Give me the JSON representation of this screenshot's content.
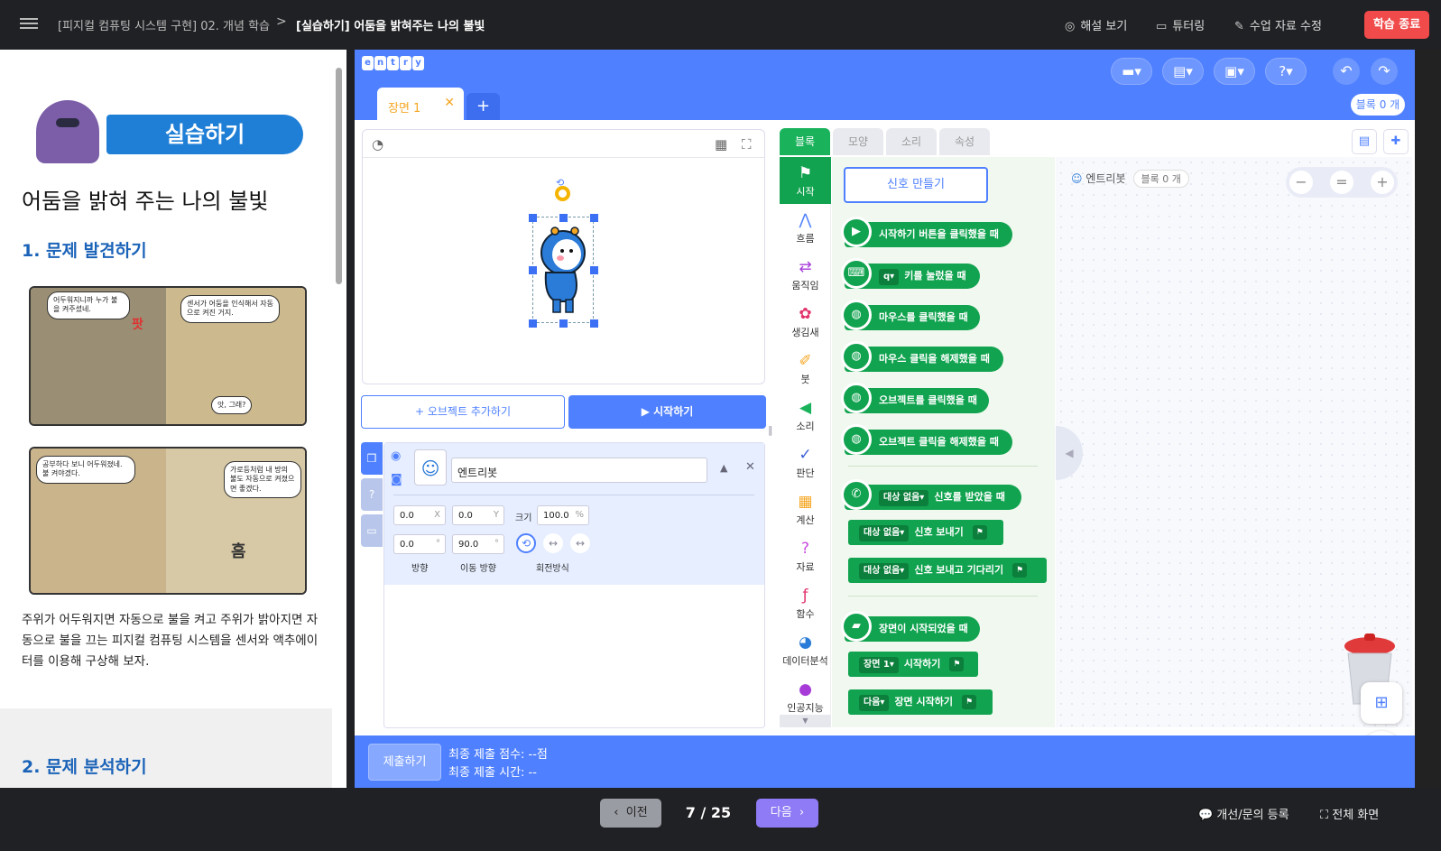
{
  "topbar": {
    "breadcrumb": "[피지컬 컴퓨팅 시스템 구현] 02. 개념 학습",
    "breadcrumb_sep": ">",
    "current": "[실습하기] 어둠을 밝혀주는 나의 불빛",
    "actions": [
      {
        "label": "해설 보기",
        "icon": "check-circle-icon"
      },
      {
        "label": "튜터링",
        "icon": "chat-edit-icon"
      },
      {
        "label": "수업 자료 수정",
        "icon": "edit-icon"
      }
    ],
    "finish": "학습 종료"
  },
  "lesson": {
    "badge": "실습하기",
    "title": "어둠을 밝혀 주는 나의 불빛",
    "section1": "1. 문제 발견하기",
    "comic1": {
      "bubble_a": "어두워지니까 누가 불을 켜주셨네.",
      "bubble_b": "센서가 어둠을 인식해서 자동으로 켜진 거지.",
      "bubble_c": "앗, 그래?",
      "sfx": "팟"
    },
    "comic2": {
      "bubble_a": "공부하다 보니 어두워졌네. 불 켜야겠다.",
      "bubble_b": "가로등처럼 내 방의 불도 자동으로 켜졌으면 좋겠다.",
      "sfx": "흠"
    },
    "paragraph": "주위가 어두워지면 자동으로 불을 켜고 주위가 밝아지면 자동으로 불을 끄는 피지컬 컴퓨팅 시스템을 센서와 액추에이터를 이용해 구상해 보자.",
    "section2": "2. 문제 분석하기"
  },
  "entry": {
    "logo": [
      "e",
      "n",
      "t",
      "r",
      "y"
    ],
    "block_count_top": "블록 0 개",
    "scene_tab": "장면 1",
    "scene_add": "+",
    "add_object": "+ 오브젝트 추가하기",
    "start": "▶ 시작하기",
    "object": {
      "name": "엔트리봇",
      "x": "0.0",
      "x_unit": "X",
      "y": "0.0",
      "y_unit": "Y",
      "size_label": "크기",
      "size": "100.0",
      "size_unit": "%",
      "direction": "0.0",
      "move_direction": "90.0",
      "deg": "°",
      "direction_label": "방향",
      "move_direction_label": "이동 방향",
      "rotation_label": "회전방식"
    },
    "tabs": [
      "블록",
      "모양",
      "소리",
      "속성"
    ],
    "categories": [
      "시작",
      "흐름",
      "움직임",
      "생김새",
      "붓",
      "소리",
      "판단",
      "계산",
      "자료",
      "함수",
      "데이터분석",
      "인공지능"
    ],
    "signal_button": "신호 만들기",
    "blocks": {
      "b1": "시작하기 버튼을 클릭했을 때",
      "b2_key": "q",
      "b2": "키를 눌렀을 때",
      "b3": "마우스를 클릭했을 때",
      "b4": "마우스 클릭을 해제했을 때",
      "b5": "오브젝트를 클릭했을 때",
      "b6": "오브젝트 클릭을 해제했을 때",
      "none": "대상 없음",
      "b7": "신호를 받았을 때",
      "b8": "신호 보내기",
      "b9": "신호 보내고 기다리기",
      "b10": "장면이 시작되었을 때",
      "scene1": "장면 1",
      "b11": "시작하기",
      "next": "다음",
      "b12": "장면 시작하기"
    },
    "canvas_object": "엔트리봇",
    "canvas_blocks": "블록 0 개",
    "zoom": [
      "−",
      "=",
      "+"
    ],
    "submit": "제출하기",
    "score": "최종 제출 점수: --점",
    "time": "최종 제출 시간: --"
  },
  "footer": {
    "prev": "이전",
    "page": "7 / 25",
    "next": "다음",
    "feedback": "개선/문의 등록",
    "fullscreen": "전체 화면"
  }
}
